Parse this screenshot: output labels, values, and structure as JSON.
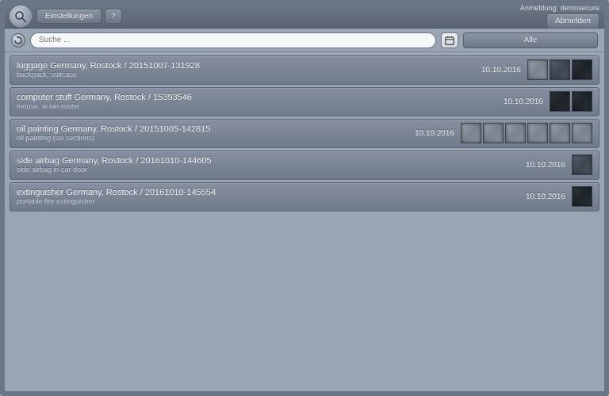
{
  "header": {
    "settings_label": "Einstellungen",
    "help_label": "?",
    "login_prefix": "Anmeldung:",
    "login_user": "demosecure",
    "logout_label": "Abmelden"
  },
  "search": {
    "placeholder": "Suche ...",
    "filter_label": "Alle"
  },
  "items": [
    {
      "title": "luggage Germany, Rostock / 20151007-131928",
      "desc": "backpack, suitcase",
      "date": "10.10.2016",
      "thumb_styles": [
        "light",
        "",
        "dark"
      ]
    },
    {
      "title": "computer stuff Germany, Rostock / 15393546",
      "desc": "mouse, w-lan router",
      "date": "10.10.2016",
      "thumb_styles": [
        "dark",
        "dark"
      ]
    },
    {
      "title": "oil painting Germany, Rostock / 20151005-142815",
      "desc": "oil painting (six sections)",
      "date": "10.10.2016",
      "thumb_styles": [
        "light",
        "light",
        "light",
        "light",
        "light",
        "light"
      ]
    },
    {
      "title": "side airbag Germany, Rostock / 20161010-144605",
      "desc": "side airbag in car door",
      "date": "10.10.2016",
      "thumb_styles": [
        ""
      ]
    },
    {
      "title": "extinguisher Germany, Rostock / 20161010-145554",
      "desc": "portable fire extinguisher",
      "date": "10.10.2016",
      "thumb_styles": [
        "dark"
      ]
    }
  ]
}
